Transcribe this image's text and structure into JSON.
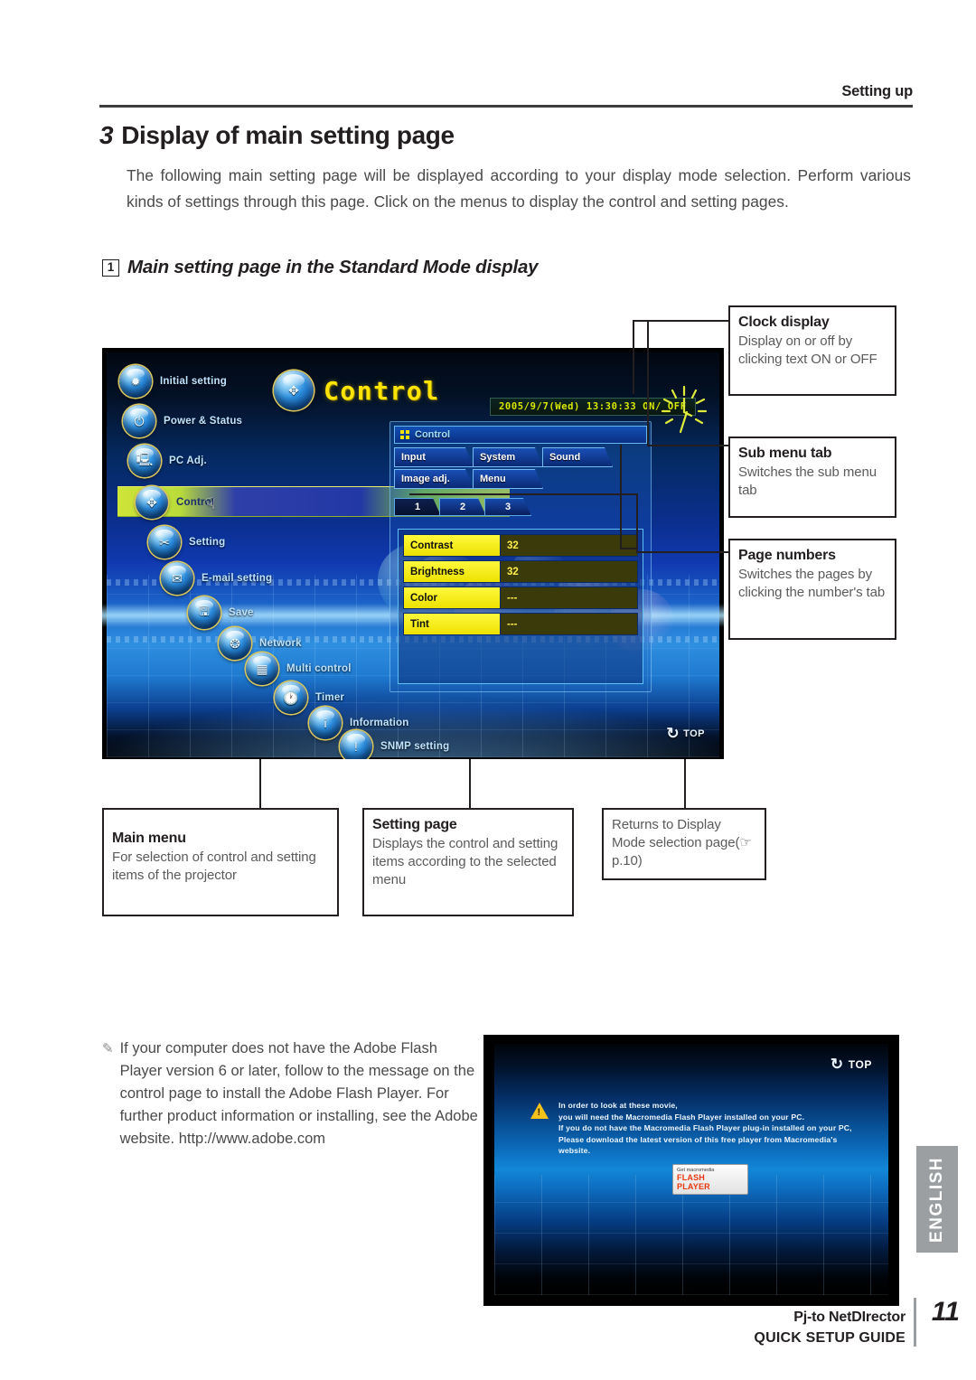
{
  "header": {
    "running_head": "Setting up"
  },
  "section": {
    "number": "3",
    "title": "Display of main setting page"
  },
  "intro": "The following main setting page will be displayed according to your display mode selection. Perform various kinds of settings through this page. Click on the menus to display the control and setting pages.",
  "subheading": {
    "number": "1",
    "text": "Main setting page in the Standard Mode display"
  },
  "screenshot": {
    "title": "Control",
    "clock": "2005/9/7(Wed)  13:30:33  ON/ OFF",
    "menu_items": [
      {
        "label": "Initial setting",
        "icon": "gear-projector-icon"
      },
      {
        "label": "Power & Status",
        "icon": "power-icon"
      },
      {
        "label": "PC Adj.",
        "icon": "monitor-icon"
      },
      {
        "label": "Control",
        "icon": "dpad-icon"
      },
      {
        "label": "Setting",
        "icon": "tools-icon"
      },
      {
        "label": "E-mail setting",
        "icon": "envelope-icon"
      },
      {
        "label": "Save",
        "icon": "floppy-icon"
      },
      {
        "label": "Network",
        "icon": "network-icon"
      },
      {
        "label": "Multi control",
        "icon": "multi-control-icon"
      },
      {
        "label": "Timer",
        "icon": "clock-icon"
      },
      {
        "label": "Information",
        "icon": "info-icon"
      },
      {
        "label": "SNMP setting",
        "icon": "snmp-icon"
      }
    ],
    "panel": {
      "title": "Control",
      "tabs_row1": [
        "Input",
        "System",
        "Sound"
      ],
      "tabs_row2": [
        "Image adj.",
        "Menu"
      ],
      "page_tabs": [
        "1",
        "2",
        "3"
      ],
      "settings": [
        {
          "name": "Contrast",
          "value": "32"
        },
        {
          "name": "Brightness",
          "value": "32"
        },
        {
          "name": "Color",
          "value": "---"
        },
        {
          "name": "Tint",
          "value": "---"
        }
      ]
    },
    "top_button": "TOP"
  },
  "callouts": {
    "clock_display": {
      "title": "Clock display",
      "body": "Display on or off by clicking text ON or OFF"
    },
    "sub_menu_tab": {
      "title": "Sub menu tab",
      "body": "Switches the sub menu tab"
    },
    "page_numbers": {
      "title": "Page numbers",
      "body": "Switches the pages by clicking the number's tab"
    },
    "main_menu": {
      "title": "Main menu",
      "body": "For selection of  control and setting items of the projector"
    },
    "setting_page": {
      "title": "Setting page",
      "body": "Displays the control and setting items according to the selected menu"
    },
    "returns": {
      "title": "",
      "body": "Returns to Display Mode selection page(☞ p.10)"
    }
  },
  "note": {
    "bullet": "✎",
    "text": "If your computer does not have the Adobe Flash Player version 6 or later, follow to the message on the control page to install the Adobe Flash Player. For further product information or installing, see the Adobe website. http://www.adobe.com"
  },
  "flash_screenshot": {
    "top_button": "TOP",
    "warning_lines": [
      "In order to look at these movie,",
      "you will need the Macromedia Flash Player installed on your PC.",
      "If you do not have the Macromedia Flash Player plug-in installed on your PC,",
      "Please download the latest version of this free player from Macromedia's website."
    ],
    "get_flash": {
      "line1": "Get macromedia",
      "line2": "FLASH",
      "line3": "PLAYER"
    }
  },
  "footer": {
    "language_tab": "ENGLISH",
    "product": "Pj-to NetDIrector",
    "guide": "QUICK SETUP GUIDE",
    "page_number": "11"
  },
  "colors": {
    "ink": "#231f20",
    "body_gray": "#4a4a4a",
    "tab_gray": "#9b9fa2",
    "accent_yellow": "#ffe400"
  }
}
